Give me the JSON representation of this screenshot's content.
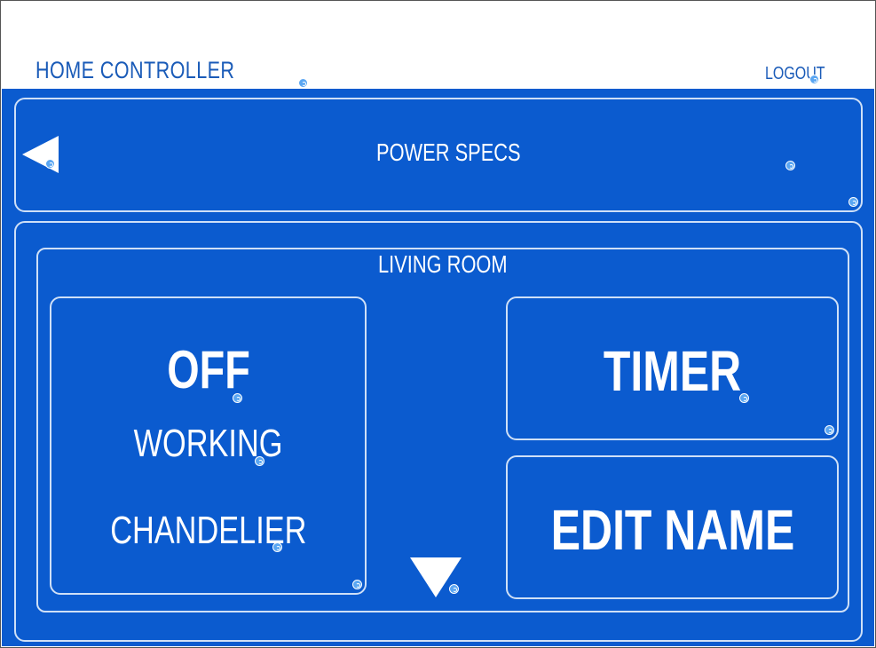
{
  "header": {
    "title": "HOME CONTROLLER",
    "logout_label": "LOGOUT"
  },
  "spec_bar": {
    "back_icon": "back-arrow-icon",
    "title": "POWER SPECS"
  },
  "room": {
    "name": "LIVING ROOM",
    "device": {
      "state": "OFF",
      "status": "WORKING",
      "name": "CHANDELIER"
    },
    "timer_label": "TIMER",
    "edit_name_label": "EDIT NAME",
    "scroll_icon": "down-arrow-icon"
  },
  "colors": {
    "background": "#0b5bcf",
    "header_text": "#1a5bb8",
    "panel_border": "#cfe0f7",
    "text": "#ffffff",
    "hotspot_marker": "#5aa6f2"
  }
}
